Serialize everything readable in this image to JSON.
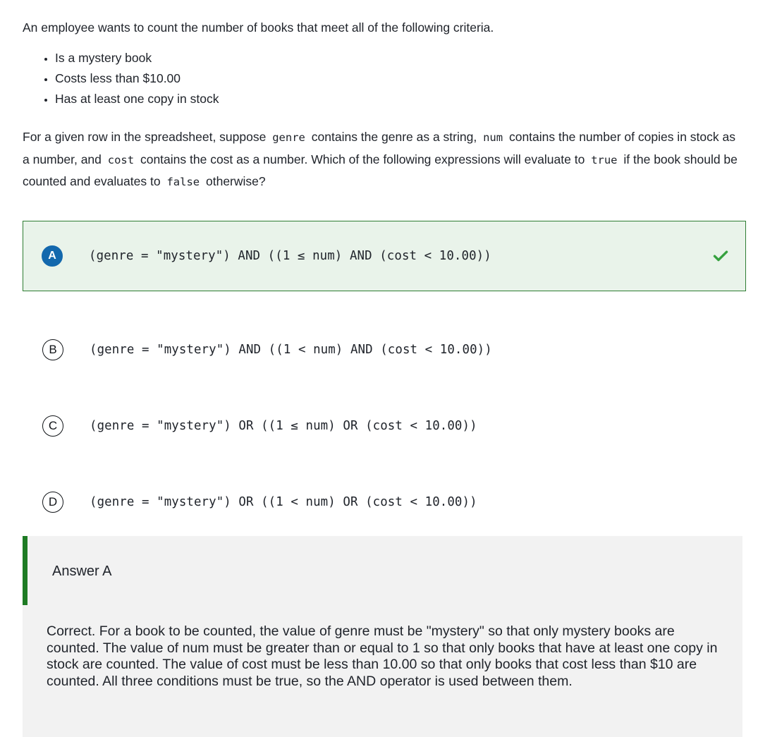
{
  "question": {
    "intro": "An employee wants to count the number of books that meet all of the following criteria.",
    "criteria": [
      "Is a mystery book",
      "Costs less than $10.00",
      "Has at least one copy in stock"
    ],
    "paragraph": {
      "p1": "For a given row in the spreadsheet, suppose",
      "code1": "genre",
      "p2": "contains the genre as a string,",
      "code2": "num",
      "p3": "contains the number of copies in stock as a number, and",
      "code3": "cost",
      "p4": "contains the cost as a number. Which of the following expressions will evaluate to",
      "code4": "true",
      "p5": "if the book should be counted and evaluates to",
      "code5": "false",
      "p6": "otherwise?"
    }
  },
  "options": [
    {
      "letter": "A",
      "expression": "(genre = \"mystery\") AND ((1 ≤ num) AND (cost < 10.00))",
      "selected": true,
      "correct": true,
      "mark_icon": "check-icon"
    },
    {
      "letter": "B",
      "expression": "(genre = \"mystery\") AND ((1 < num) AND (cost < 10.00))",
      "selected": false,
      "correct": false,
      "mark_icon": ""
    },
    {
      "letter": "C",
      "expression": "(genre = \"mystery\") OR ((1 ≤ num) OR (cost < 10.00))",
      "selected": false,
      "correct": false,
      "mark_icon": ""
    },
    {
      "letter": "D",
      "expression": "(genre = \"mystery\") OR ((1 < num) OR (cost < 10.00))",
      "selected": false,
      "correct": false,
      "mark_icon": ""
    }
  ],
  "answer_panel": {
    "title": "Answer A",
    "explanation": "Correct. For a book to be counted, the value of genre must be \"mystery\" so that only mystery books are counted. The value of num must be greater than or equal to 1 so that only books that have at least one copy in stock are counted. The value of cost must be less than 10.00 so that only books that cost less than $10 are counted. All three conditions must be true, so the AND operator is used between them."
  },
  "colors": {
    "correct_background": "#e9f3ea",
    "correct_border": "#2e7d32",
    "check_green": "#36a13f",
    "badge_blue": "#1368ad",
    "answer_bar_green": "#1e7b24",
    "answer_background": "#f2f2f2",
    "text": "#20242b"
  }
}
